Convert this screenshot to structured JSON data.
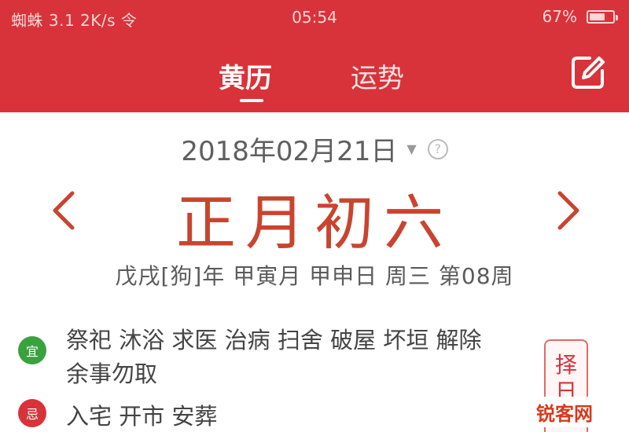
{
  "status_bar": {
    "left_text": "蜘蛛 3.1 2K/s 令",
    "time": "05:54",
    "battery_text": "67%",
    "battery_level": 0.67
  },
  "header": {
    "tabs": [
      {
        "label": "黄历",
        "active": true
      },
      {
        "label": "运势",
        "active": false
      }
    ],
    "edit_icon": "edit-square-icon",
    "background_color": "#d8333a"
  },
  "calendar": {
    "solar_date": "2018年02月21日",
    "help_symbol": "?",
    "lunar_date": "正月初六",
    "ganzhi": "戊戌[狗]年 甲寅月 甲申日 周三 第08周",
    "prev_icon": "chevron-left-icon",
    "next_icon": "chevron-right-icon",
    "accent_color": "#c9442f"
  },
  "almanac": {
    "yi_label": "宜",
    "yi_text": "祭祀 沐浴 求医 治病 扫舍 破屋 坏垣 解除 余事勿取",
    "ji_label": "忌",
    "ji_text": "入宅 开市 安葬",
    "side_tag": "择日"
  },
  "watermark": "锐客网"
}
